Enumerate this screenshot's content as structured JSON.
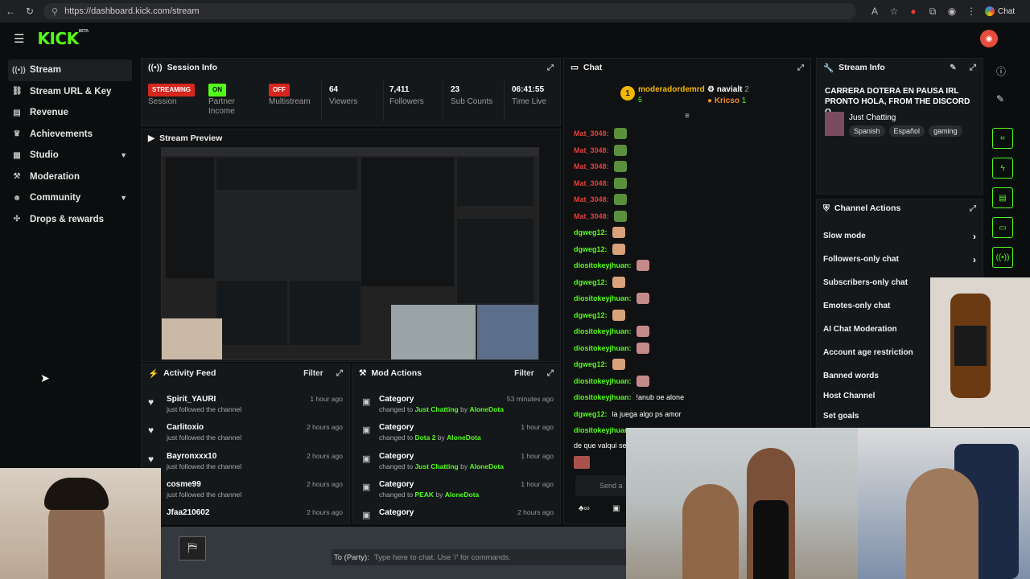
{
  "browser": {
    "url": "https://dashboard.kick.com/stream",
    "chat_button": "Chat"
  },
  "brand": {
    "logo": "KICK",
    "beta": "BETA",
    "accent": "#53fc18"
  },
  "sidebar": {
    "items": [
      {
        "label": "Stream",
        "icon": "broadcast-icon",
        "active": true
      },
      {
        "label": "Stream URL & Key",
        "icon": "link-icon"
      },
      {
        "label": "Revenue",
        "icon": "chart-icon"
      },
      {
        "label": "Achievements",
        "icon": "trophy-icon"
      },
      {
        "label": "Studio",
        "icon": "layout-icon",
        "expandable": true
      },
      {
        "label": "Moderation",
        "icon": "hammer-icon"
      },
      {
        "label": "Community",
        "icon": "users-icon",
        "expandable": true
      },
      {
        "label": "Drops & rewards",
        "icon": "gift-icon"
      }
    ]
  },
  "session": {
    "title": "Session Info",
    "stats": [
      {
        "value": "STREAMING",
        "label": "Session",
        "kind": "badge-red"
      },
      {
        "value": "ON",
        "label": "Partner Income",
        "kind": "badge-green"
      },
      {
        "value": "OFF",
        "label": "Multistream",
        "kind": "badge-red"
      },
      {
        "value": "64",
        "label": "Viewers"
      },
      {
        "value": "7,411",
        "label": "Followers"
      },
      {
        "value": "23",
        "label": "Sub Counts"
      },
      {
        "value": "06:41:55",
        "label": "Time Live"
      }
    ]
  },
  "preview": {
    "title": "Stream Preview"
  },
  "activity": {
    "title": "Activity Feed",
    "filter": "Filter",
    "items": [
      {
        "name": "Spirit_YAURI",
        "sub": "just followed the channel",
        "time": "1 hour ago"
      },
      {
        "name": "Carlitoxio",
        "sub": "just followed the channel",
        "time": "2 hours ago"
      },
      {
        "name": "Bayronxxx10",
        "sub": "just followed the channel",
        "time": "2 hours ago"
      },
      {
        "name": "cosme99",
        "sub": "just followed the channel",
        "time": "2 hours ago"
      },
      {
        "name": "Jfaa210602",
        "sub": "just followed the channel",
        "time": "2 hours ago"
      }
    ]
  },
  "mod": {
    "title": "Mod Actions",
    "filter": "Filter",
    "items": [
      {
        "name": "Category",
        "pre": "changed to ",
        "target": "Just Chatting",
        "by": " by ",
        "user": "AloneDota",
        "time": "53 minutes ago"
      },
      {
        "name": "Category",
        "pre": "changed to ",
        "target": "Dota 2",
        "by": " by ",
        "user": "AloneDota",
        "time": "1 hour ago"
      },
      {
        "name": "Category",
        "pre": "changed to ",
        "target": "Just Chatting",
        "by": " by ",
        "user": "AloneDota",
        "time": "1 hour ago"
      },
      {
        "name": "Category",
        "pre": "changed to ",
        "target": "PEAK",
        "by": " by ",
        "user": "AloneDota",
        "time": "1 hour ago"
      },
      {
        "name": "Category",
        "pre": "",
        "target": "",
        "by": "",
        "user": "",
        "time": "2 hours ago"
      }
    ]
  },
  "chat": {
    "title": "Chat",
    "leaderboard": [
      {
        "rank": "1",
        "name": "moderadordemrd",
        "count": "5"
      },
      {
        "name": "navialt",
        "count": "2"
      },
      {
        "name": "Kricso",
        "count": "1"
      }
    ],
    "messages": [
      {
        "user": "Mat_3048:",
        "color": "#e0413b",
        "text": ""
      },
      {
        "user": "Mat_3048:",
        "color": "#e0413b",
        "text": ""
      },
      {
        "user": "Mat_3048:",
        "color": "#e0413b",
        "text": ""
      },
      {
        "user": "Mat_3048:",
        "color": "#e0413b",
        "text": ""
      },
      {
        "user": "Mat_3048:",
        "color": "#e0413b",
        "text": ""
      },
      {
        "user": "Mat_3048:",
        "color": "#e0413b",
        "text": ""
      },
      {
        "user": "dgweg12:",
        "color": "#53fc18",
        "text": ""
      },
      {
        "user": "dgweg12:",
        "color": "#53fc18",
        "text": ""
      },
      {
        "user": "diositokeyjhuan:",
        "color": "#53fc18",
        "text": ""
      },
      {
        "user": "dgweg12:",
        "color": "#53fc18",
        "text": ""
      },
      {
        "user": "diositokeyjhuan:",
        "color": "#53fc18",
        "text": ""
      },
      {
        "user": "dgweg12:",
        "color": "#53fc18",
        "text": ""
      },
      {
        "user": "diositokeyjhuan:",
        "color": "#53fc18",
        "text": ""
      },
      {
        "user": "diositokeyjhuan:",
        "color": "#53fc18",
        "text": ""
      },
      {
        "user": "dgweg12:",
        "color": "#53fc18",
        "text": ""
      },
      {
        "user": "diositokeyjhuan:",
        "color": "#53fc18",
        "text": ""
      },
      {
        "user": "diositokeyjhuan:",
        "color": "#53fc18",
        "text": "!anub oe alone"
      },
      {
        "user": "dgweg12:",
        "color": "#53fc18",
        "text": "la juega algo ps amor"
      },
      {
        "user": "diositokeyjhuan:",
        "color": "#53fc18",
        "text": ""
      }
    ],
    "trailing": "de que valqui se",
    "send_placeholder": "Send a"
  },
  "stream_info": {
    "title": "Stream Info",
    "stream_title": "CARRERA DOTERA EN PAUSA IRL PRONTO HOLA, FROM THE DISCORD O...",
    "category": "Just Chatting",
    "tags": [
      "Spanish",
      "Español",
      "gaming"
    ]
  },
  "channel_actions": {
    "title": "Channel Actions",
    "items": [
      {
        "label": "Slow mode",
        "arrow": true
      },
      {
        "label": "Followers-only chat",
        "arrow": true
      },
      {
        "label": "Subscribers-only chat"
      },
      {
        "label": "Emotes-only chat"
      },
      {
        "label": "AI Chat Moderation"
      },
      {
        "label": "Account age restriction"
      },
      {
        "label": "Banned words"
      },
      {
        "label": "Host Channel"
      },
      {
        "label": "Set goals"
      }
    ]
  },
  "party": {
    "label": "To (Party):",
    "placeholder": "Type here to chat. Use '/' for commands."
  }
}
